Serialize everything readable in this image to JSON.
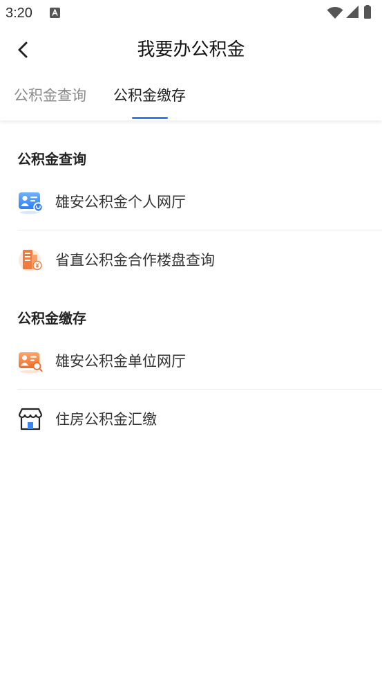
{
  "status_bar": {
    "time": "3:20",
    "icons": [
      "notification-a-icon",
      "wifi-icon",
      "signal-icon",
      "battery-icon"
    ]
  },
  "header": {
    "title": "我要办公积金",
    "back_icon": "chevron-left-icon"
  },
  "tabs": [
    {
      "label": "公积金查询",
      "selected": false
    },
    {
      "label": "公积金缴存",
      "selected": true
    }
  ],
  "colors": {
    "accent": "#2f7cf6",
    "tab_inactive": "#8a8a8a",
    "tab_active": "#1f1f1f",
    "text": "#333333"
  },
  "sections": [
    {
      "title": "公积金查询",
      "items": [
        {
          "label": "雄安公积金个人网厅",
          "icon": "id-card-icon"
        },
        {
          "label": "省直公积金合作楼盘查询",
          "icon": "building-icon"
        }
      ]
    },
    {
      "title": "公积金缴存",
      "items": [
        {
          "label": "雄安公积金单位网厅",
          "icon": "company-card-search-icon"
        },
        {
          "label": "住房公积金汇缴",
          "icon": "store-icon"
        }
      ]
    }
  ]
}
